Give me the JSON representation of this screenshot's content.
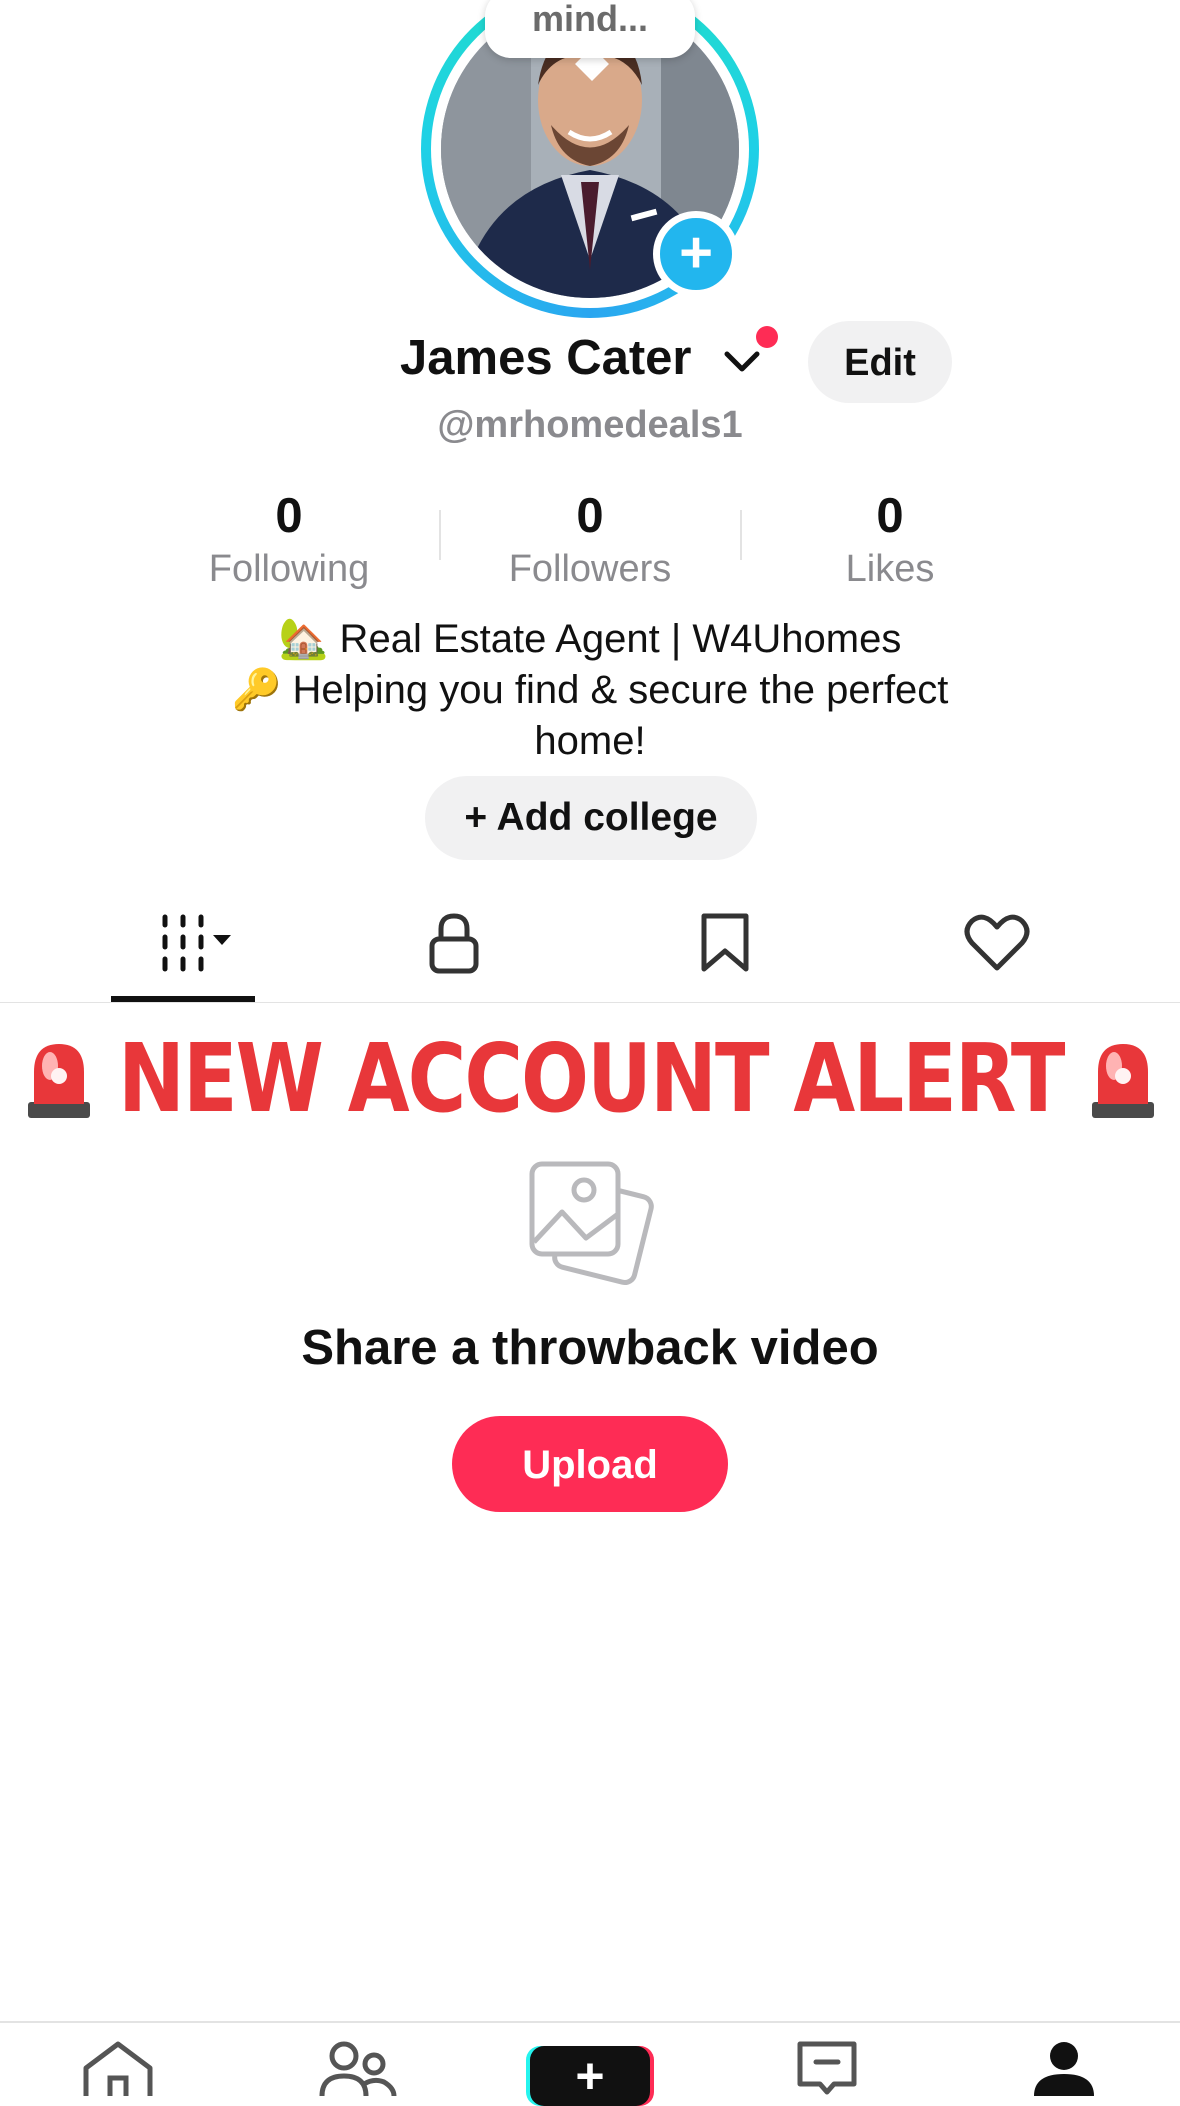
{
  "profile": {
    "bubble_text": "mind...",
    "display_name": "James Cater",
    "username": "@mrhomedeals1",
    "edit_label": "Edit"
  },
  "stats": [
    {
      "value": "0",
      "label": "Following"
    },
    {
      "value": "0",
      "label": "Followers"
    },
    {
      "value": "0",
      "label": "Likes"
    }
  ],
  "bio": {
    "line1": "🏡 Real Estate Agent | W4Uhomes",
    "line2": "🔑 Helping you find & secure the perfect",
    "line3": "home!"
  },
  "add_college_label": "+ Add college",
  "tabs": [
    {
      "icon": "videos-grid-icon"
    },
    {
      "icon": "lock-icon"
    },
    {
      "icon": "bookmark-icon"
    },
    {
      "icon": "heart-icon"
    }
  ],
  "content": {
    "alert_text": "NEW ACCOUNT ALERT",
    "empty_title": "Share a throwback video",
    "upload_label": "Upload"
  },
  "bottom_nav": [
    {
      "icon": "home-icon"
    },
    {
      "icon": "friends-icon"
    },
    {
      "icon": "create-icon"
    },
    {
      "icon": "inbox-icon"
    },
    {
      "icon": "profile-icon"
    }
  ],
  "colors": {
    "accent": "#fe2c55",
    "alert": "#e8373a",
    "ring": "#1fd0e6",
    "add_badge": "#22b6ee"
  }
}
